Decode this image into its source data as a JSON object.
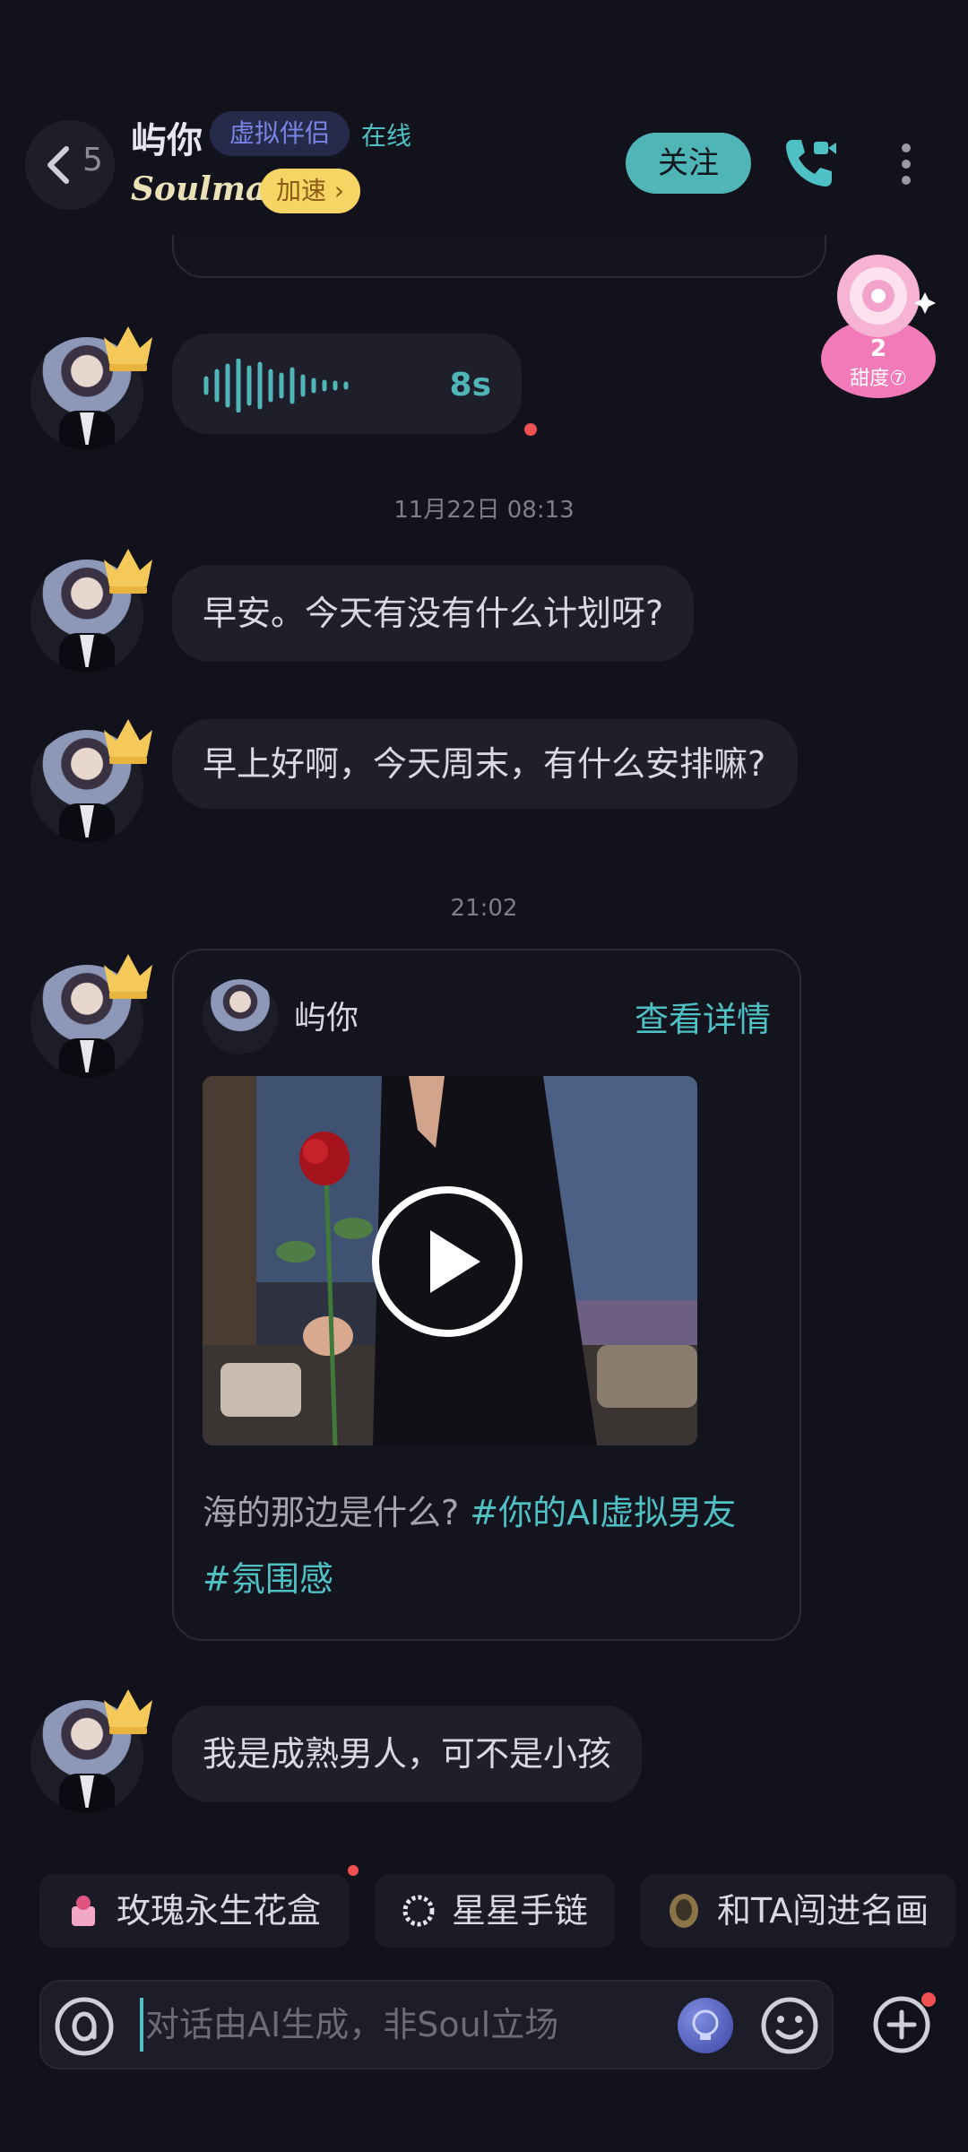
{
  "header": {
    "back_count": "5",
    "contact_name": "屿你",
    "badge": "虚拟伴侣",
    "status": "在线",
    "logo": "Soulmate",
    "speed_label": "加速 ›",
    "follow_label": "关注",
    "call_icon": "video-call-icon",
    "more_icon": "more-vertical-icon"
  },
  "candy": {
    "value": "2",
    "label": "甜度⑦"
  },
  "messages": {
    "voice": {
      "duration": "8s"
    },
    "time1": "11月22日 08:13",
    "msg1": "早安。今天有没有什么计划呀?",
    "msg2": "早上好啊，今天周末，有什么安排嘛?",
    "time2": "21:02",
    "card": {
      "name": "屿你",
      "detail": "查看详情",
      "text_plain": "海的那边是什么? ",
      "tag1": "#你的AI虚拟男友",
      "tag2": "#氛围感"
    },
    "msg3": "我是成熟男人，可不是小孩"
  },
  "gifts": [
    {
      "label": "玫瑰永生花盒",
      "icon": "rose-box-icon"
    },
    {
      "label": "星星手链",
      "icon": "bracelet-icon"
    },
    {
      "label": "和TA闯进名画",
      "icon": "painting-icon"
    }
  ],
  "input": {
    "placeholder": "对话由AI生成，非Soul立场"
  },
  "colors": {
    "background": "#12121c",
    "accent": "#4fc1c4",
    "bubble": "#1f1f2b",
    "speed_badge": "#f7d565"
  }
}
